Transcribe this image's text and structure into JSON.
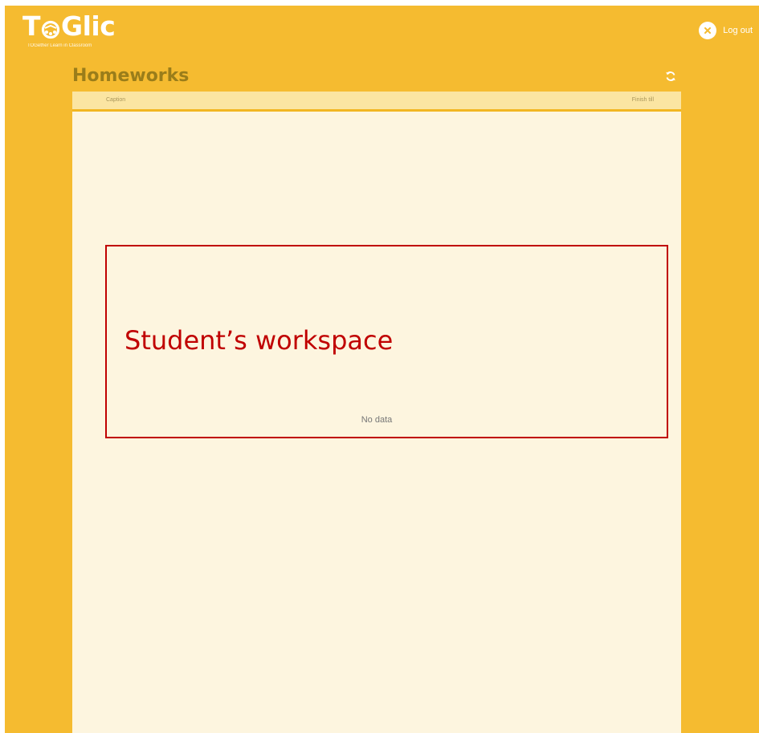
{
  "brand": {
    "name_prefix": "T",
    "name_suffix": "Glic",
    "tagline": "TOGether Learn in Classroom",
    "logo_icon": "gear-o-icon"
  },
  "header": {
    "logout_label": "Log out",
    "logout_icon": "close-icon"
  },
  "homeworks": {
    "title": "Homeworks",
    "refresh_icon": "refresh-icon",
    "columns": [
      "Caption",
      "Finish till"
    ],
    "empty_text": "No data"
  },
  "annotation": {
    "label": "Student’s workspace",
    "color": "#c00000"
  },
  "colors": {
    "background": "#f5bb30",
    "panel": "#fdf5df",
    "header_row": "#fbe5a2",
    "title": "#9a7d1a"
  }
}
